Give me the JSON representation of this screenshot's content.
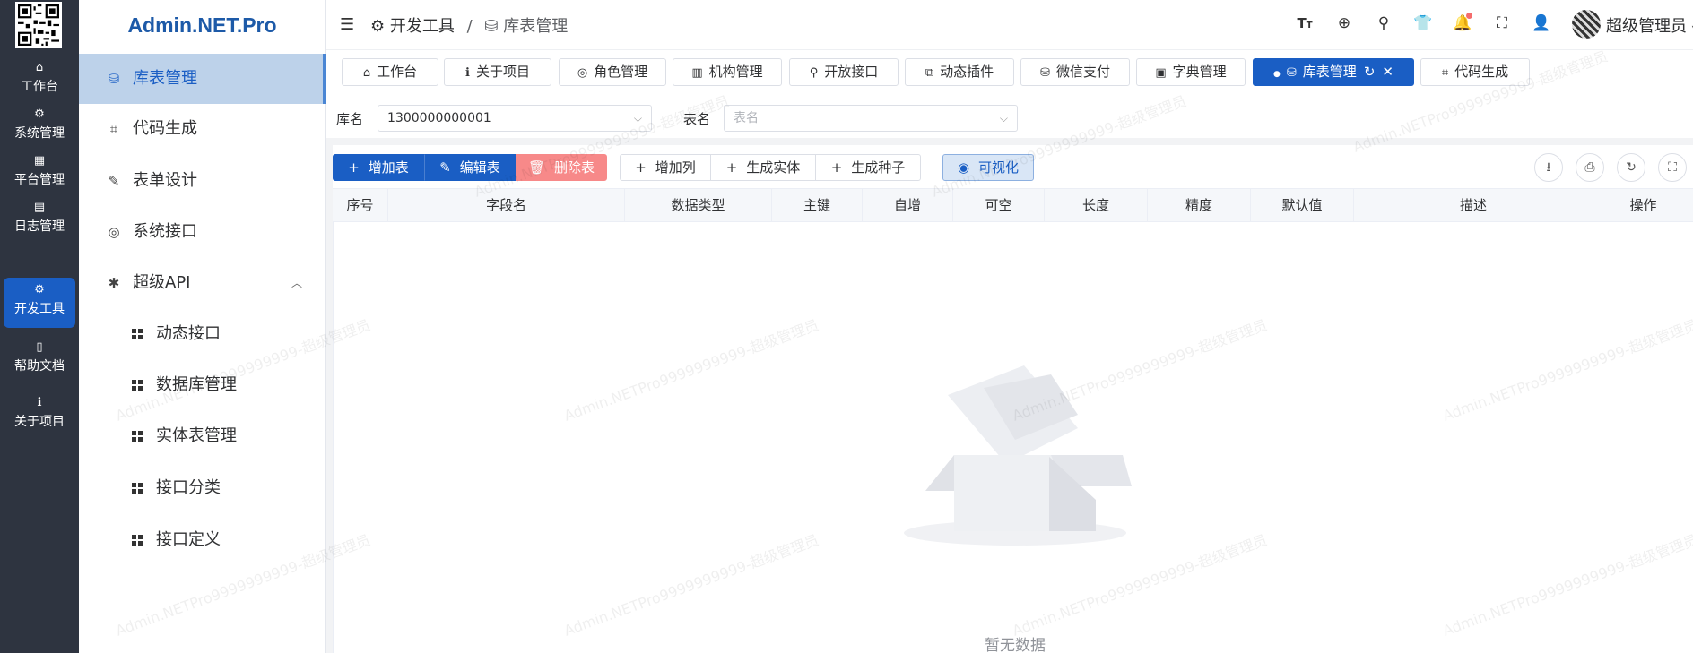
{
  "rail": {
    "items": [
      {
        "icon": "⌂",
        "label": "工作台"
      },
      {
        "icon": "⚙",
        "label": "系统管理"
      },
      {
        "icon": "▦",
        "label": "平台管理"
      },
      {
        "icon": "▤",
        "label": "日志管理"
      },
      {
        "icon": "⚙",
        "label": "开发工具"
      },
      {
        "icon": "▯",
        "label": "帮助文档"
      },
      {
        "icon": "ℹ",
        "label": "关于项目"
      }
    ]
  },
  "menu": {
    "logo": "Admin.NET.Pro",
    "items": [
      {
        "icon": "⛁",
        "label": "库表管理"
      },
      {
        "icon": "⌗",
        "label": "代码生成"
      },
      {
        "icon": "✎",
        "label": "表单设计"
      },
      {
        "icon": "◎",
        "label": "系统接口"
      },
      {
        "icon": "✱",
        "label": "超级API",
        "arrow": "︿"
      }
    ],
    "subitems": [
      {
        "label": "动态接口"
      },
      {
        "label": "数据库管理"
      },
      {
        "label": "实体表管理"
      },
      {
        "label": "接口分类"
      },
      {
        "label": "接口定义"
      }
    ]
  },
  "header": {
    "menu_icon": "☰",
    "breadcrumb": [
      {
        "icon": "⚙",
        "label": "开发工具"
      },
      {
        "icon": "⛁",
        "label": "库表管理"
      }
    ],
    "separator": "/",
    "icons": [
      "font-size-icon",
      "translate-icon",
      "search-icon",
      "theme-icon",
      "bell-icon",
      "fullscreen-icon",
      "user-icon"
    ],
    "username": "超级管理员",
    "username_caret": "▾"
  },
  "tabs": [
    {
      "icon": "⌂",
      "label": "工作台"
    },
    {
      "icon": "ℹ",
      "label": "关于项目"
    },
    {
      "icon": "◎",
      "label": "角色管理"
    },
    {
      "icon": "▥",
      "label": "机构管理"
    },
    {
      "icon": "⚲",
      "label": "开放接口"
    },
    {
      "icon": "⧉",
      "label": "动态插件"
    },
    {
      "icon": "⛁",
      "label": "微信支付"
    },
    {
      "icon": "▣",
      "label": "字典管理"
    },
    {
      "icon": "⛁",
      "label": "库表管理",
      "refresh": "↻",
      "close": "✕"
    },
    {
      "icon": "⌗",
      "label": "代码生成"
    }
  ],
  "filter": {
    "db_label": "库名",
    "db_value": "1300000000001",
    "table_label": "表名",
    "table_placeholder": "表名",
    "chevron": "⌵"
  },
  "toolbar": {
    "add_table": "增加表",
    "edit_table": "编辑表",
    "delete_table": "删除表",
    "add_column": "增加列",
    "gen_entity": "生成实体",
    "gen_seed": "生成种子",
    "visualize": "可视化",
    "icons": {
      "add": "+",
      "edit": "✎",
      "delete": "🗑",
      "visualize": "◉",
      "download": "⭳",
      "print": "⎙",
      "refresh": "↻",
      "fullscreen": "⛶"
    }
  },
  "table": {
    "columns": [
      "序号",
      "字段名",
      "数据类型",
      "主键",
      "自增",
      "可空",
      "长度",
      "精度",
      "默认值",
      "描述",
      "操作"
    ],
    "rows": [],
    "empty_text": "暂无数据"
  },
  "watermark": "Admin.NETPro9999999999-超级管理员",
  "colors": {
    "primary": "#1a5ec4",
    "danger": "#f78989",
    "rail": "#2e3440",
    "menu_active": "#bdd2ea"
  }
}
